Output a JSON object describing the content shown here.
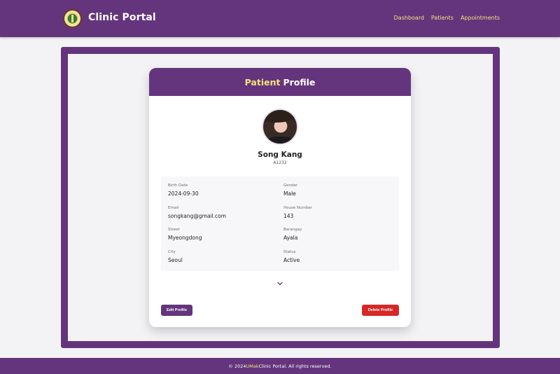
{
  "header": {
    "brand": "Clinic Portal",
    "logo_icon": "clinic-seal-icon",
    "nav": [
      {
        "label": "Dashboard"
      },
      {
        "label": "Patients"
      },
      {
        "label": "Appointments"
      }
    ]
  },
  "card": {
    "title_accent": "Patient",
    "title_main": "Profile",
    "name": "Song Kang",
    "patient_id": "A1232",
    "fields": [
      {
        "label": "Birth Date",
        "value": "2024-09-30"
      },
      {
        "label": "Gender",
        "value": "Male"
      },
      {
        "label": "Email",
        "value": "songkang@gmail.com"
      },
      {
        "label": "House Number",
        "value": "143"
      },
      {
        "label": "Street",
        "value": "Myeongdong"
      },
      {
        "label": "Barangay",
        "value": "Ayala"
      },
      {
        "label": "City",
        "value": "Seoul"
      },
      {
        "label": "Status",
        "value": "Active"
      }
    ],
    "expand_icon": "chevron-down-icon",
    "edit_label": "Edit Profile",
    "delete_label": "Delete Profile"
  },
  "footer": {
    "prefix": "© 2024 ",
    "accent": "UMak",
    "suffix": " Clinic Portal. All rights reserved."
  },
  "colors": {
    "primary": "#64357d",
    "accent": "#f6e27a",
    "danger": "#d62828",
    "background": "#f3f3f5"
  }
}
